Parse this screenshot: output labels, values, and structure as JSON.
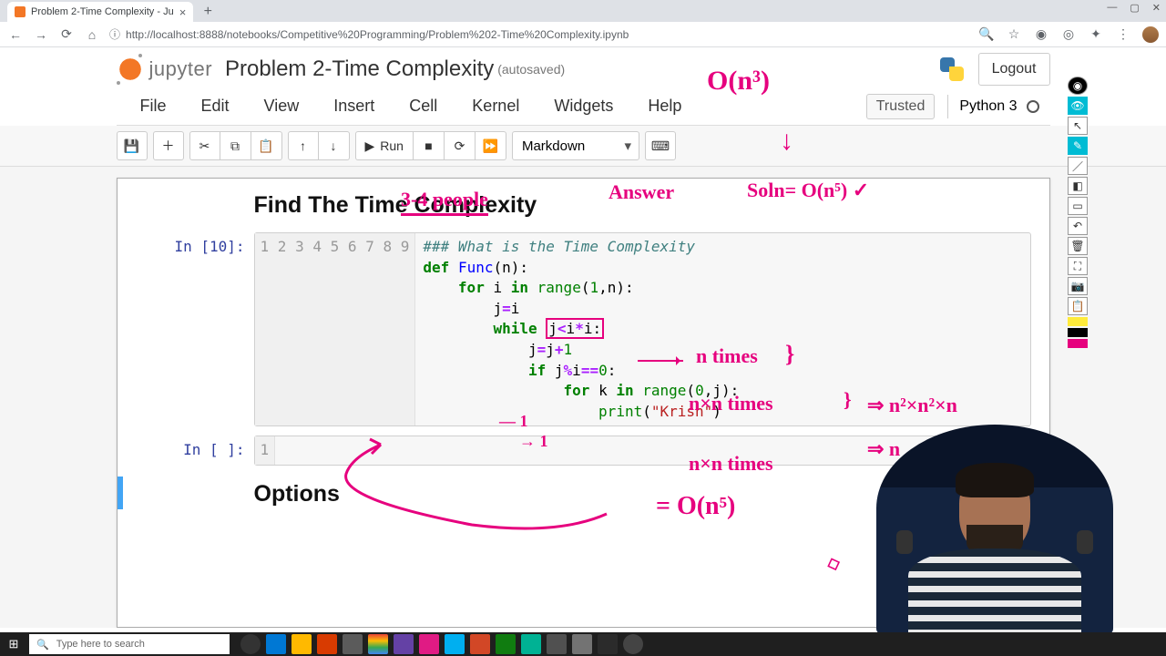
{
  "browser": {
    "tab_title": "Problem 2-Time Complexity - Ju",
    "url": "http://localhost:8888/notebooks/Competitive%20Programming/Problem%202-Time%20Complexity.ipynb"
  },
  "jupyter": {
    "logo_text": "jupyter",
    "notebook_title": "Problem 2-Time Complexity",
    "autosave": "(autosaved)",
    "logout": "Logout",
    "kernel_name": "Python 3",
    "trusted": "Trusted"
  },
  "menu": [
    "File",
    "Edit",
    "View",
    "Insert",
    "Cell",
    "Kernel",
    "Widgets",
    "Help"
  ],
  "toolbar": {
    "run_label": "Run",
    "celltype": "Markdown"
  },
  "cells": {
    "heading1": "Find The Time Complexity",
    "code_prompt": "In [10]:",
    "empty_prompt": "In [ ]:",
    "heading2": "Options",
    "code_lines": {
      "l1_comment": "### What is the Time Complexity",
      "l2_def": "def",
      "l2_name": "Func",
      "l2_rest": "(n):",
      "l3_for": "for",
      "l3_i": "i",
      "l3_in": "in",
      "l3_range": "range",
      "l3_args": "(",
      "l3_one": "1",
      "l3_comma": ",n):",
      "l4": "j",
      "l4_eq": "=",
      "l4_i": "i",
      "l5_while": "while",
      "l5_cond1": "j",
      "l5_lt": "<",
      "l5_cond2": "i",
      "l5_mul": "*",
      "l5_cond3": "i:",
      "l6_j": "j",
      "l6_eq": "=",
      "l6_j2": "j",
      "l6_plus": "+",
      "l6_one": "1",
      "l7_if": "if",
      "l7_j": "j",
      "l7_mod": "%",
      "l7_i": "i",
      "l7_eqeq": "==",
      "l7_zero": "0",
      "l7_colon": ":",
      "l8_for": "for",
      "l8_k": "k",
      "l8_in": "in",
      "l8_range": "range",
      "l8_args": "(",
      "l8_zero": "0",
      "l8_comma": ",j):",
      "l9_print": "print",
      "l9_args": "(",
      "l9_str": "\"Krish\"",
      "l9_close": ")"
    },
    "gutter": [
      "1",
      "2",
      "3",
      "4",
      "5",
      "6",
      "7",
      "8",
      "9"
    ],
    "gutter_empty": [
      "1"
    ]
  },
  "annotations": {
    "top_bigO": "O(n³)",
    "people": "3-4 people",
    "answer": "Answer",
    "soln": "Soln= O(n⁵) ✓",
    "n_times": "n times",
    "nxn_times": "n×n times",
    "nxn_times2": "n×n times",
    "impl1": "⇒ n²×n²×n",
    "impl2": "⇒ n",
    "eq_bigO": "= O(n⁵)",
    "line6_note": "1",
    "line7_note": "→ 1"
  },
  "taskbar": {
    "search_placeholder": "Type here to search"
  }
}
